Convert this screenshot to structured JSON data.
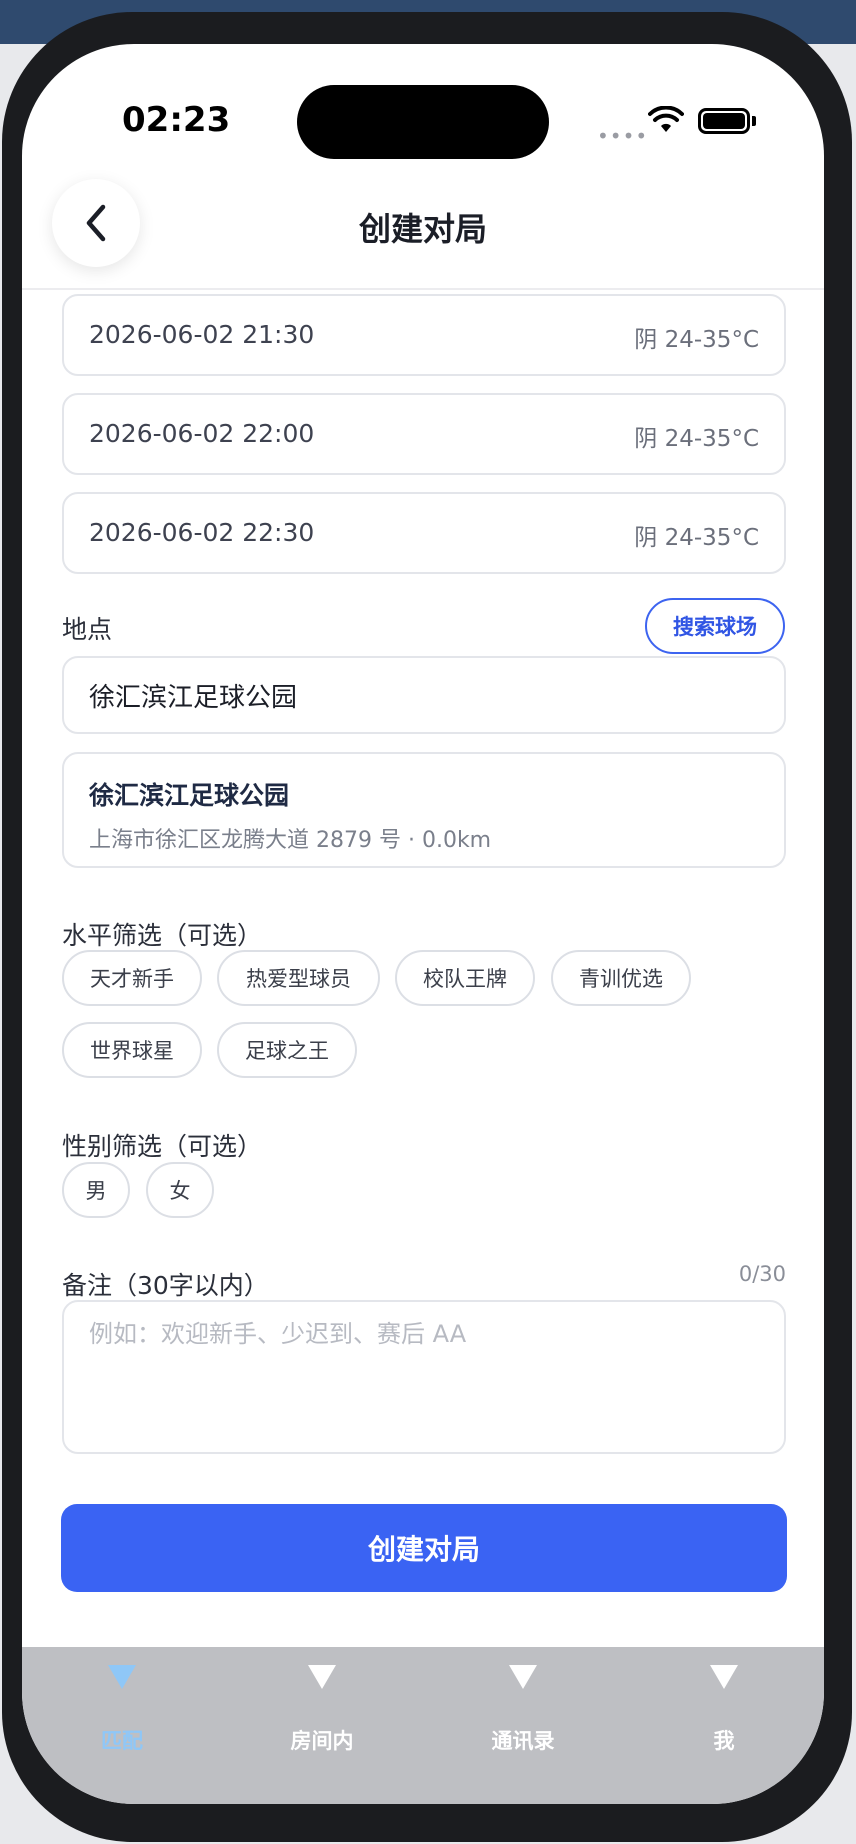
{
  "status_bar": {
    "time": "02:23",
    "signal": "••••"
  },
  "nav": {
    "title": "创建对局"
  },
  "time_slots": [
    {
      "datetime": "2026-06-02 21:30",
      "weather": "阴 24-35°C"
    },
    {
      "datetime": "2026-06-02 22:00",
      "weather": "阴 24-35°C"
    },
    {
      "datetime": "2026-06-02 22:30",
      "weather": "阴 24-35°C"
    }
  ],
  "location": {
    "label": "地点",
    "search_button": "搜索球场",
    "value": "徐汇滨江足球公园",
    "result": {
      "name": "徐汇滨江足球公园",
      "address": "上海市徐汇区龙腾大道 2879 号 · 0.0km"
    }
  },
  "level_filter": {
    "label": "水平筛选（可选）",
    "options": [
      "天才新手",
      "热爱型球员",
      "校队王牌",
      "青训优选",
      "世界球星",
      "足球之王"
    ]
  },
  "gender_filter": {
    "label": "性别筛选（可选）",
    "options": [
      "男",
      "女"
    ]
  },
  "remarks": {
    "label": "备注（30字以内）",
    "count": "0/30",
    "value": "",
    "placeholder": "例如：欢迎新手、少迟到、赛后 AA"
  },
  "submit": {
    "label": "创建对局"
  },
  "tabs": [
    {
      "label": "匹配",
      "active": true
    },
    {
      "label": "房间内",
      "active": false
    },
    {
      "label": "通讯录",
      "active": false
    },
    {
      "label": "我",
      "active": false
    }
  ],
  "colors": {
    "accent": "#3a63f3",
    "tab_active": "#8fc7f7",
    "tabbar_bg": "#bebfc3"
  }
}
